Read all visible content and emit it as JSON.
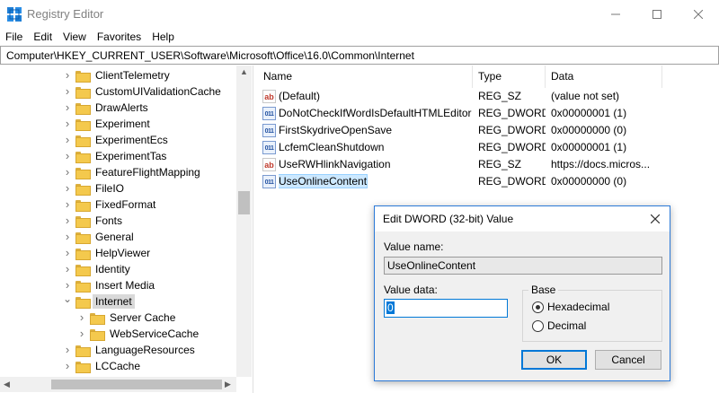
{
  "window": {
    "title": "Registry Editor",
    "min_icon": "minimize-icon",
    "max_icon": "maximize-icon",
    "close_icon": "close-icon"
  },
  "menu": [
    "File",
    "Edit",
    "View",
    "Favorites",
    "Help"
  ],
  "address": "Computer\\HKEY_CURRENT_USER\\Software\\Microsoft\\Office\\16.0\\Common\\Internet",
  "tree": {
    "items": [
      {
        "label": "ClientTelemetry",
        "expandable": true
      },
      {
        "label": "CustomUIValidationCache",
        "expandable": true
      },
      {
        "label": "DrawAlerts",
        "expandable": true
      },
      {
        "label": "Experiment",
        "expandable": true
      },
      {
        "label": "ExperimentEcs",
        "expandable": true
      },
      {
        "label": "ExperimentTas",
        "expandable": true
      },
      {
        "label": "FeatureFlightMapping",
        "expandable": true
      },
      {
        "label": "FileIO",
        "expandable": true
      },
      {
        "label": "FixedFormat",
        "expandable": true
      },
      {
        "label": "Fonts",
        "expandable": true
      },
      {
        "label": "General",
        "expandable": true
      },
      {
        "label": "HelpViewer",
        "expandable": true
      },
      {
        "label": "Identity",
        "expandable": true
      },
      {
        "label": "Insert Media",
        "expandable": true
      },
      {
        "label": "Internet",
        "expandable": true,
        "expanded": true,
        "selected": true
      },
      {
        "label": "Server Cache",
        "expandable": true,
        "child": true
      },
      {
        "label": "WebServiceCache",
        "expandable": true,
        "child": true
      },
      {
        "label": "LanguageResources",
        "expandable": true
      },
      {
        "label": "LCCache",
        "expandable": true
      }
    ]
  },
  "list": {
    "headers": {
      "name": "Name",
      "type": "Type",
      "data": "Data"
    },
    "rows": [
      {
        "icon": "string-value-icon",
        "icon_text": "ab",
        "name": "(Default)",
        "type": "REG_SZ",
        "data": "(value not set)"
      },
      {
        "icon": "binary-value-icon",
        "icon_text": "011",
        "name": "DoNotCheckIfWordIsDefaultHTMLEditor",
        "type": "REG_DWORD",
        "data": "0x00000001 (1)"
      },
      {
        "icon": "binary-value-icon",
        "icon_text": "011",
        "name": "FirstSkydriveOpenSave",
        "type": "REG_DWORD",
        "data": "0x00000000 (0)"
      },
      {
        "icon": "binary-value-icon",
        "icon_text": "011",
        "name": "LcfemCleanShutdown",
        "type": "REG_DWORD",
        "data": "0x00000001 (1)"
      },
      {
        "icon": "string-value-icon",
        "icon_text": "ab",
        "name": "UseRWHlinkNavigation",
        "type": "REG_SZ",
        "data": "https://docs.micros..."
      },
      {
        "icon": "binary-value-icon",
        "icon_text": "011",
        "name": "UseOnlineContent",
        "type": "REG_DWORD",
        "data": "0x00000000 (0)",
        "selected": true
      }
    ]
  },
  "dialog": {
    "title": "Edit DWORD (32-bit) Value",
    "value_name_label": "Value name:",
    "value_name": "UseOnlineContent",
    "value_data_label": "Value data:",
    "value_data": "0",
    "base_label": "Base",
    "radio_hex": "Hexadecimal",
    "radio_dec": "Decimal",
    "base_selected": "Hexadecimal",
    "ok": "OK",
    "cancel": "Cancel"
  }
}
